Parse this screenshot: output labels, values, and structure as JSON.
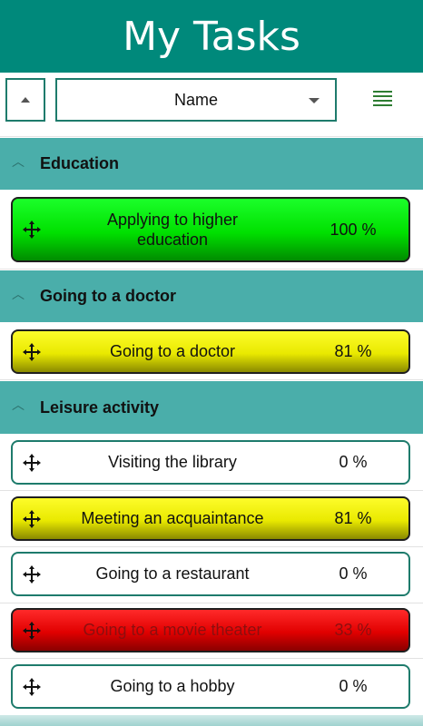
{
  "app": {
    "title": "My Tasks"
  },
  "toolbar": {
    "sort_by": "Name"
  },
  "groups": [
    {
      "label": "Education"
    },
    {
      "label": "Going to a doctor"
    },
    {
      "label": "Leisure activity"
    }
  ],
  "tasks": [
    {
      "name": "Applying to higher education",
      "percent": "100 %"
    },
    {
      "name": "Going to a doctor",
      "percent": "81 %"
    },
    {
      "name": "Visiting the library",
      "percent": "0 %"
    },
    {
      "name": "Meeting an acquaintance",
      "percent": "81 %"
    },
    {
      "name": "Going to a restaurant",
      "percent": "0 %"
    },
    {
      "name": "Going to a movie theater",
      "percent": "33 %"
    },
    {
      "name": "Going to a hobby",
      "percent": "0 %"
    }
  ],
  "icons": {
    "collapse": "chevron-up-icon",
    "sort": "sort-ascending-icon",
    "dropdown": "chevron-down-icon",
    "menu": "list-icon",
    "drag": "move-icon"
  },
  "colors": {
    "header": "#00897b",
    "group": "#4aaeaa",
    "complete": "#00e000",
    "partial": "#e9e900",
    "behind": "#e10000",
    "border": "#1e7b6c"
  }
}
